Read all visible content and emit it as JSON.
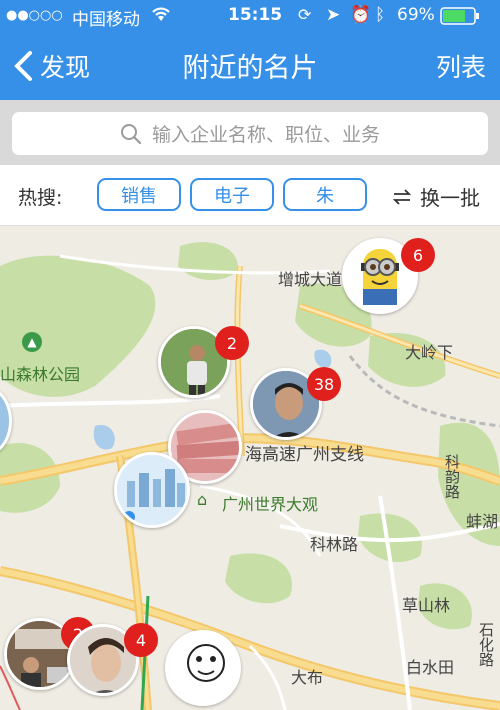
{
  "status_bar": {
    "signal": "●●○○○",
    "carrier": "中国移动",
    "time": "15:15",
    "battery": "69%"
  },
  "nav": {
    "back_label": "发现",
    "title": "附近的名片",
    "right_label": "列表"
  },
  "search": {
    "placeholder": "输入企业名称、职位、业务"
  },
  "hot": {
    "label": "热搜:",
    "tags": [
      "销售",
      "电子",
      "朱"
    ],
    "refresh_label": "换一批"
  },
  "map": {
    "labels": [
      "增城大道",
      "大岭下",
      "山森林公园",
      "海高速广州支线",
      "广州世界大观",
      "科韵路",
      "科林路",
      "蚌湖",
      "草山林",
      "石化路",
      "白水田",
      "大布"
    ],
    "badges": [
      "6",
      "2",
      "38",
      "2",
      "4"
    ]
  },
  "colors": {
    "accent": "#3690e8",
    "badge": "#e0201c"
  }
}
